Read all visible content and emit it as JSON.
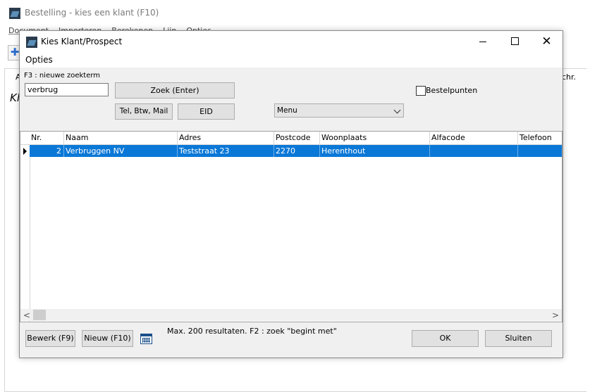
{
  "background_window": {
    "title": "Bestelling - kies een klant (F10)",
    "menu": [
      "Document",
      "Importeren",
      "Berekenen",
      "Lijn",
      "Opties"
    ],
    "col_a": "A",
    "col_schr": "chr.",
    "italic_text": "Kl"
  },
  "dialog": {
    "title": "Kies Klant/Prospect",
    "menu": {
      "opties": "Opties"
    },
    "close_glyph": "✕",
    "search": {
      "caption": "F3 : nieuwe zoekterm",
      "value": "verbrug",
      "zoek_button": "Zoek (Enter)",
      "tel_button": "Tel, Btw, Mail",
      "eid_button": "EID",
      "menu_select": "Menu",
      "bestelpunten_label": "Bestelpunten",
      "bestelpunten_checked": false
    },
    "grid": {
      "columns": [
        "Nr.",
        "Naam",
        "Adres",
        "Postcode",
        "Woonplaats",
        "Alfacode",
        "Telefoon"
      ],
      "rows": [
        {
          "nr": "2",
          "naam": "Verbruggen NV",
          "adres": "Teststraat 23",
          "postcode": "2270",
          "woonplaats": "Herenthout",
          "alfacode": "",
          "telefoon": ""
        }
      ],
      "scroll_left": "<",
      "scroll_right": ">"
    },
    "footer": {
      "bewerk_button": "Bewerk (F9)",
      "nieuw_button": "Nieuw (F10)",
      "message": "Max. 200 resultaten.  F2 : zoek \"begint met\"",
      "ok_button": "OK",
      "sluiten_button": "Sluiten"
    }
  },
  "colors": {
    "selection": "#0a78d7",
    "dialog_bg": "#f0f0f0",
    "button_bg": "#e1e1e1"
  },
  "icons": [
    "app-icon",
    "add-icon",
    "minimize-icon",
    "maximize-icon",
    "close-icon",
    "chevron-down-icon",
    "calendar-icon",
    "row-pointer-icon"
  ]
}
